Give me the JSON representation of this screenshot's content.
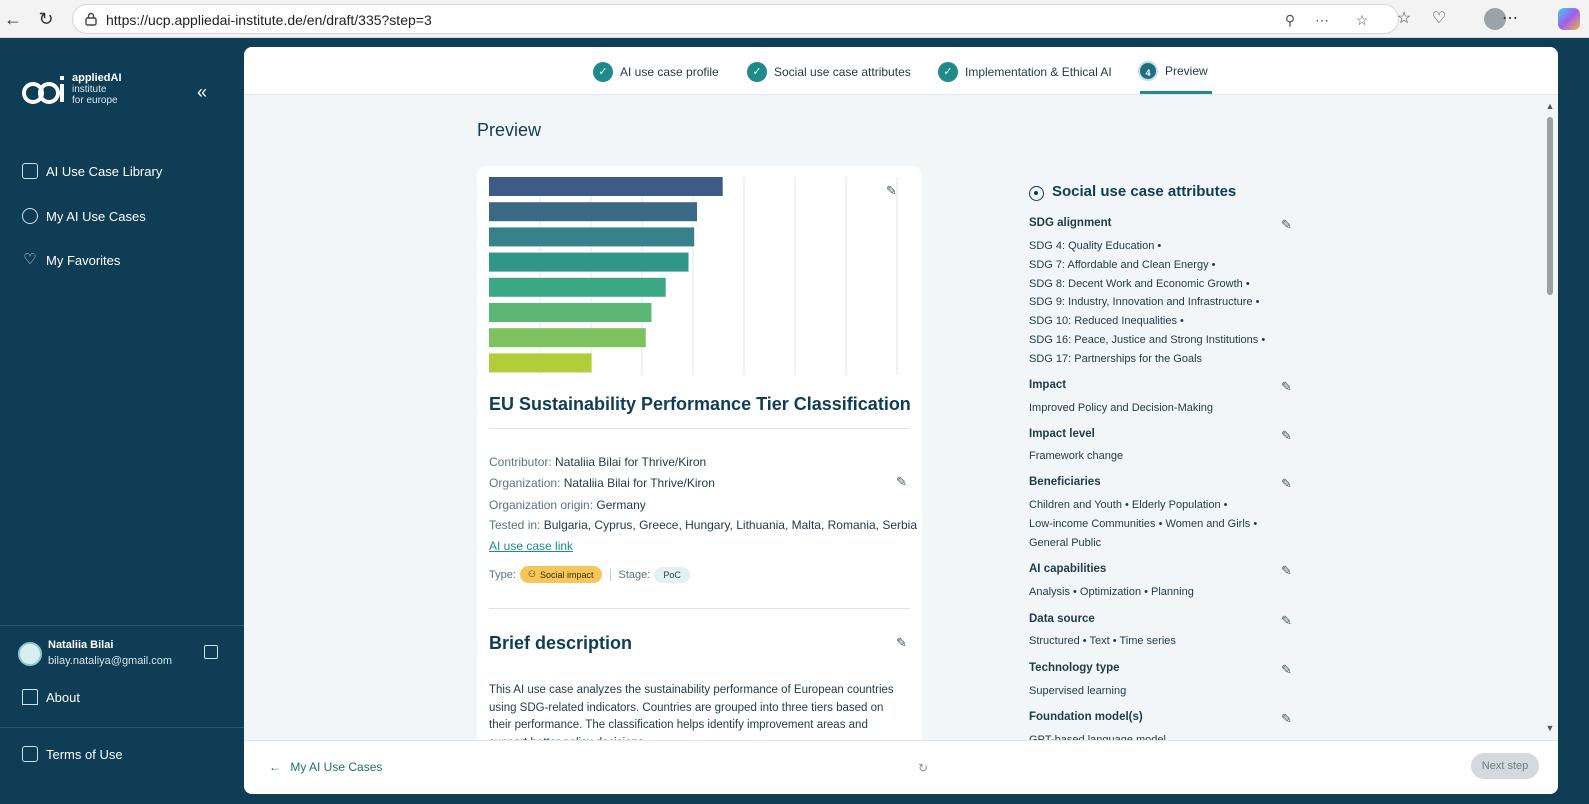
{
  "browser": {
    "url": "https://ucp.appliedai-institute.de/en/draft/335?step=3"
  },
  "sidebar": {
    "logo": {
      "line1": "appliedAI",
      "line2": "institute",
      "line3": "for europe"
    },
    "items": [
      {
        "label": "AI Use Case Library",
        "icon": "library-icon"
      },
      {
        "label": "My AI Use Cases",
        "icon": "user-circle-icon"
      },
      {
        "label": "My Favorites",
        "icon": "heart-icon"
      }
    ],
    "user": {
      "name": "Nataliia Bilai",
      "email": "bilay.nataliya@gmail.com"
    },
    "about": "About",
    "terms": "Terms of Use"
  },
  "stepper": {
    "steps": [
      {
        "label": "AI use case profile",
        "state": "done"
      },
      {
        "label": "Social use case attributes",
        "state": "done"
      },
      {
        "label": "Implementation & Ethical AI",
        "state": "done"
      },
      {
        "label": "Preview",
        "state": "current",
        "number": "4"
      }
    ]
  },
  "page": {
    "title": "Preview"
  },
  "card": {
    "title": "EU Sustainability Performance Tier Classification",
    "contributor_label": "Contributor:",
    "contributor": "Nataliia Bilai for Thrive/Kiron",
    "organization_label": "Organization:",
    "organization": "Nataliia Bilai for Thrive/Kiron",
    "origin_label": "Organization origin:",
    "origin": "Germany",
    "tested_label": "Tested in:",
    "tested": "Bulgaria, Cyprus, Greece, Hungary, Lithuania, Malta, Romania, Serbia",
    "link": "AI use case link",
    "type_label": "Type:",
    "type": "Social impact",
    "stage_label": "Stage:",
    "stage": "PoC",
    "brief_title": "Brief description",
    "brief_text": "This AI use case analyzes the sustainability performance of European countries using SDG-related indicators. Countries are grouped into three tiers based on their performance. The classification helps identify improvement areas and support better policy decisions."
  },
  "thumbnail_bars": {
    "values": [
      0.82,
      0.73,
      0.72,
      0.7,
      0.62,
      0.57,
      0.55,
      0.36
    ],
    "colors": [
      "#3e5a86",
      "#3a6a86",
      "#36818a",
      "#2f9688",
      "#3aa983",
      "#5ab874",
      "#7dc25f",
      "#b2cc3a"
    ]
  },
  "attributes": {
    "title": "Social use case attributes",
    "sdg_label": "SDG alignment",
    "sdgs": [
      "SDG 4: Quality Education •",
      "SDG 7: Affordable and Clean Energy •",
      "SDG 8: Decent Work and Economic Growth •",
      "SDG 9: Industry, Innovation and Infrastructure •",
      "SDG 10: Reduced Inequalities •",
      "SDG 16: Peace, Justice and Strong Institutions •",
      "SDG 17: Partnerships for the Goals"
    ],
    "impact_label": "Impact",
    "impact": "Improved Policy and Decision-Making",
    "impact_level_label": "Impact level",
    "impact_level": "Framework change",
    "beneficiaries_label": "Beneficiaries",
    "beneficiaries_1": "Children and Youth •  Elderly Population •",
    "beneficiaries_2": "Low-income Communities •  Women and Girls •",
    "beneficiaries_3": "General Public",
    "capabilities_label": "AI capabilities",
    "capabilities": "Analysis •  Optimization •  Planning",
    "data_source_label": "Data source",
    "data_source": "Structured •  Text •  Time series",
    "tech_label": "Technology type",
    "tech": "Supervised learning",
    "foundation_label": "Foundation model(s)",
    "foundation": "GPT-based language model"
  },
  "footer": {
    "back": "My AI Use Cases",
    "next": "Next step"
  }
}
